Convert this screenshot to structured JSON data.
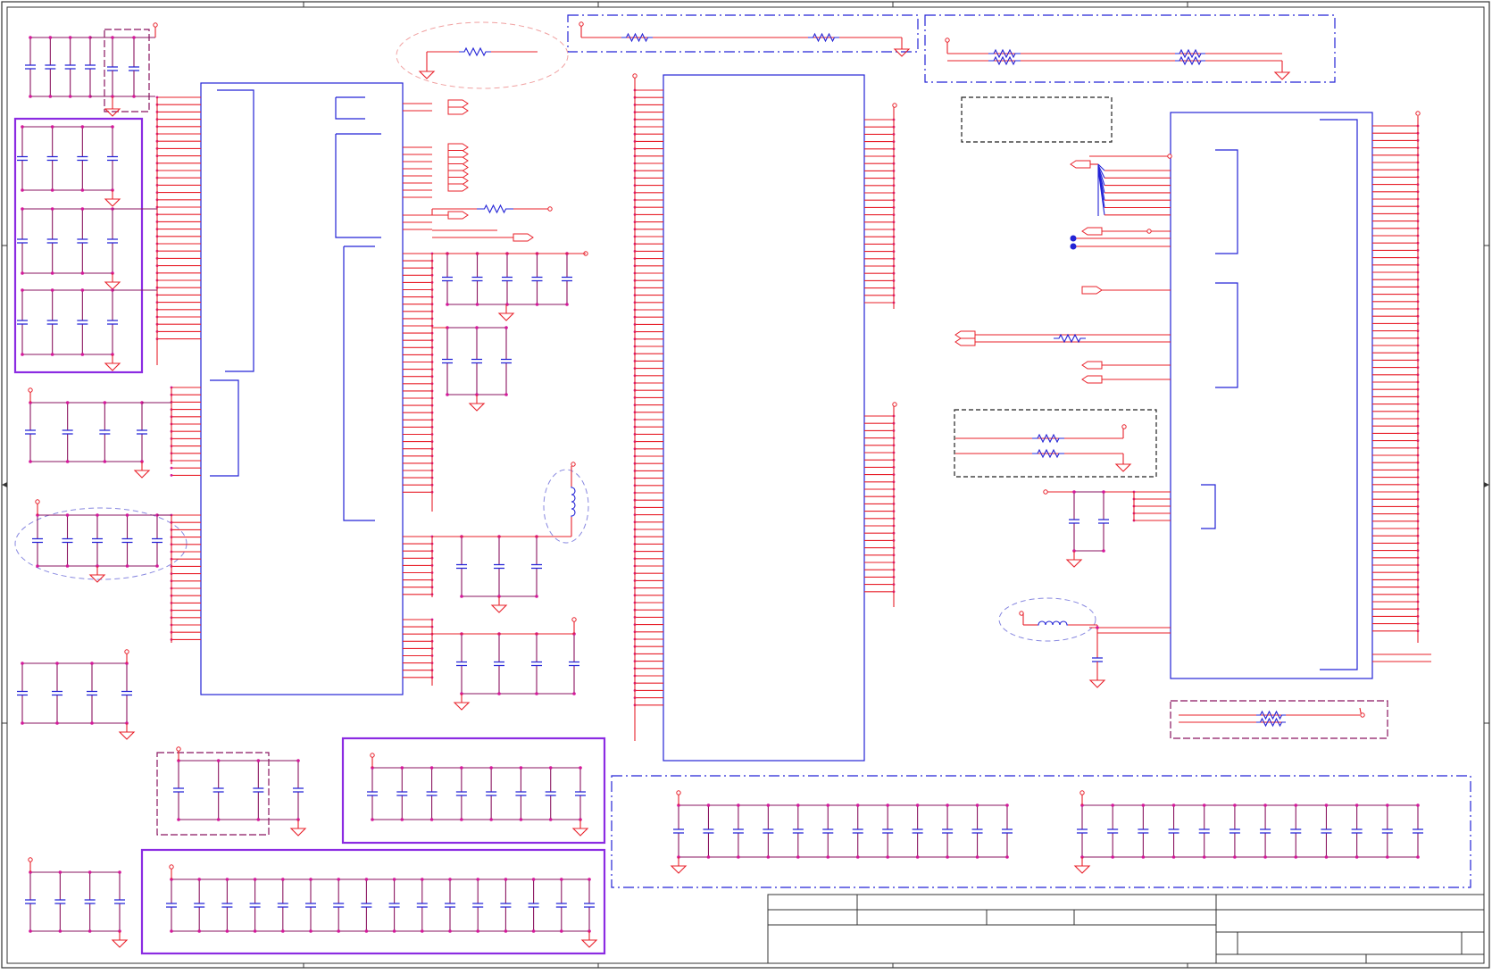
{
  "schematic": {
    "colors": {
      "wire": "#e8202a",
      "component": "#2323d6",
      "node": "#d4189a",
      "net": "#8a1560",
      "border": "#333333",
      "highlight": "#8b2be2",
      "ellipse_red": "#f0a0a0",
      "ellipse_blue": "#8888e0"
    },
    "title_block": {
      "rows": 3
    },
    "icons": [
      "resistor-icon",
      "capacitor-icon",
      "inductor-icon",
      "ground-icon",
      "power-pin-icon",
      "net-port-icon"
    ]
  }
}
